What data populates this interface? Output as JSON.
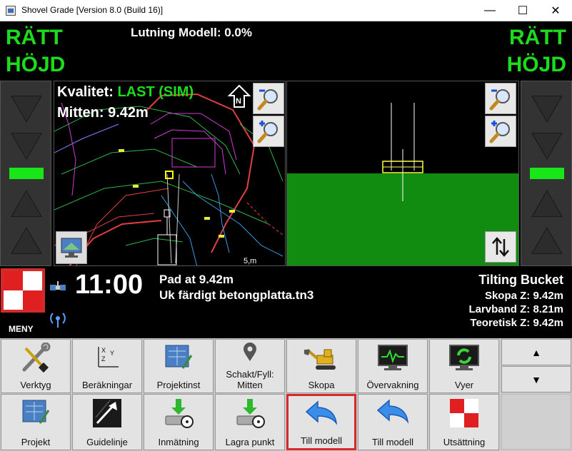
{
  "window": {
    "title": "Shovel Grade [Version 8.0 (Build 16)]",
    "controls": {
      "minimize": "—",
      "maximize": "☐",
      "close": "✕"
    }
  },
  "header": {
    "status_left_line1": "RÄTT",
    "status_left_line2": "HÖJD",
    "status_right_line1": "RÄTT",
    "status_right_line2": "HÖJD",
    "model_slope": "Lutning Modell: 0.0%"
  },
  "map": {
    "quality_label": "Kvalitet:",
    "quality_value": "LAST (SIM)",
    "middle": "Mitten: 9.42m",
    "north_letter": "N",
    "scale_text": "5,m"
  },
  "info": {
    "menu_label": "MENY",
    "time": "11:00",
    "pad": "Pad at 9.42m",
    "file": "Uk färdigt betongplatta.tn3",
    "bucket_title": "Tilting Bucket",
    "skopa_z": "Skopa Z: 9.42m",
    "larvband_z": "Larvband Z: 8.21m",
    "teoretisk_z": "Teoretisk Z: 9.42m"
  },
  "toolbar": {
    "row1": [
      "Verktyg",
      "Beräkningar",
      "Projektinst",
      "Schakt/Fyll:\nMitten",
      "Skopa",
      "Övervakning",
      "Vyer"
    ],
    "row2": [
      "Projekt",
      "Guidelinje",
      "Inmätning",
      "Lagra punkt",
      "Till modell",
      "Till modell",
      "Utsättning"
    ],
    "scroll_up": "▲",
    "scroll_down": "▼"
  },
  "colors": {
    "ok_green": "#1ddc1d",
    "ground_green": "#118c11",
    "highlight_red": "#d42a2a"
  }
}
